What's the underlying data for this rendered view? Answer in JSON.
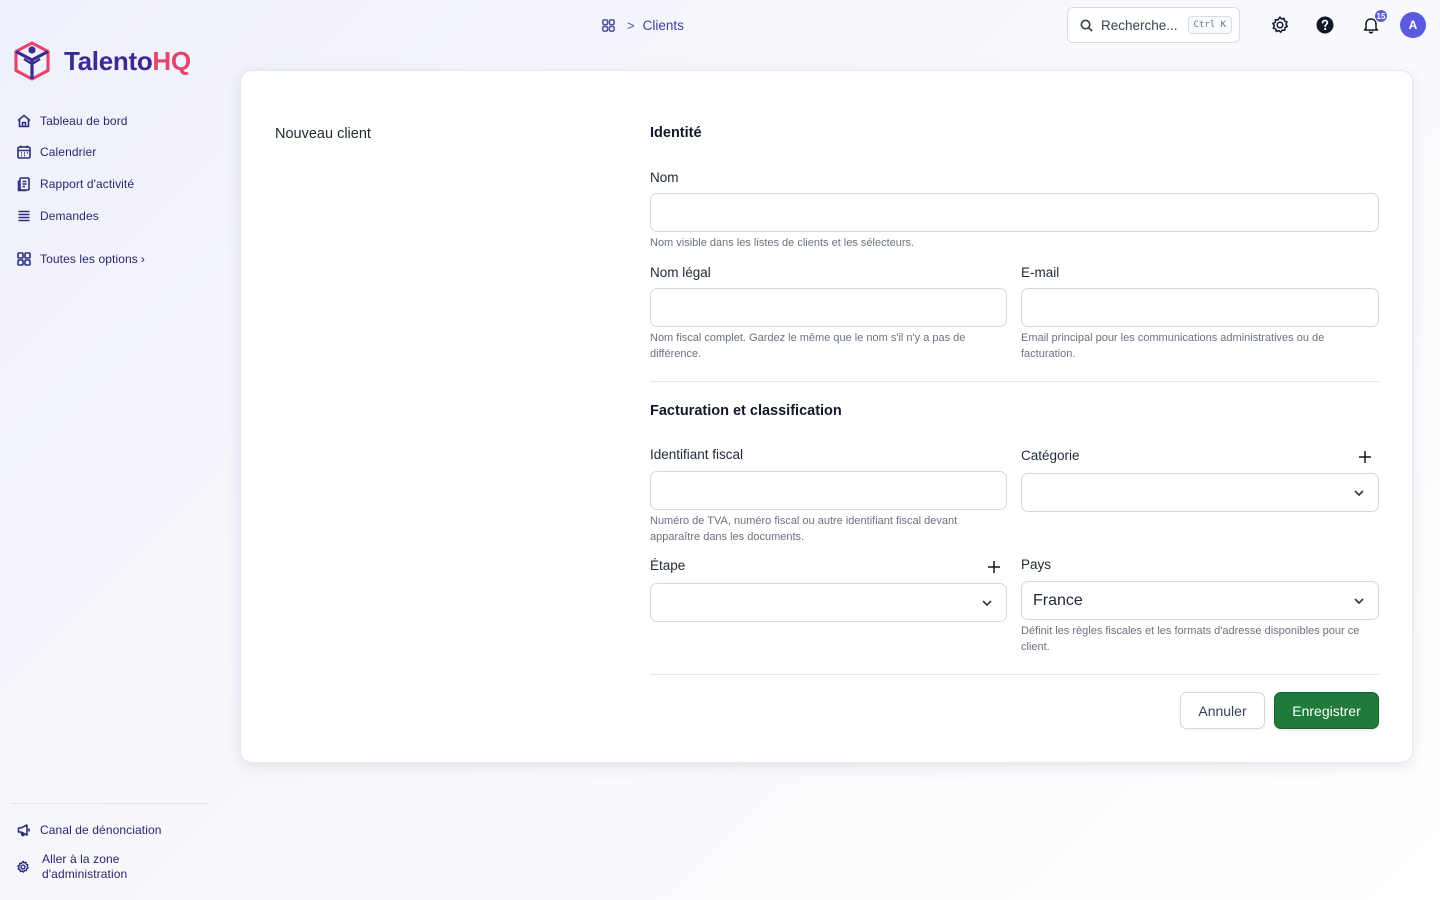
{
  "brand": {
    "name_part1": "Talento",
    "name_part2": "HQ",
    "color_primary": "#3b2a8f",
    "color_accent": "#e3456c"
  },
  "sidebar": {
    "items": [
      {
        "label": "Tableau de bord",
        "icon": "home-icon"
      },
      {
        "label": "Calendrier",
        "icon": "calendar-icon"
      },
      {
        "label": "Rapport d'activité",
        "icon": "report-icon"
      },
      {
        "label": "Demandes",
        "icon": "list-icon"
      },
      {
        "label": "Toutes les options",
        "icon": "grid-icon",
        "chevron": "›"
      }
    ],
    "footer": [
      {
        "label": "Canal de dénonciation",
        "icon": "megaphone-icon"
      },
      {
        "label_line1": "Aller à la zone",
        "label_line2": "d'administration",
        "icon": "gear-icon"
      }
    ]
  },
  "topbar": {
    "breadcrumb": {
      "current": "Clients",
      "separator": ">"
    },
    "search": {
      "placeholder": "Recherche...",
      "shortcut": "Ctrl K"
    },
    "notifications_count": "15",
    "avatar_initial": "A"
  },
  "form": {
    "title": "Nouveau client",
    "identity": {
      "section_title": "Identité",
      "nom": {
        "label": "Nom",
        "value": "",
        "help": "Nom visible dans les listes de clients et les sélecteurs."
      },
      "nom_legal": {
        "label": "Nom légal",
        "value": "",
        "help": "Nom fiscal complet. Gardez le même que le nom s'il n'y a pas de différence."
      },
      "email": {
        "label": "E-mail",
        "value": "",
        "help": "Email principal pour les communications administratives ou de facturation."
      }
    },
    "billing": {
      "section_title": "Facturation et classification",
      "identifiant_fiscal": {
        "label": "Identifiant fiscal",
        "value": "",
        "help": "Numéro de TVA, numéro fiscal ou autre identifiant fiscal devant apparaître dans les documents."
      },
      "categorie": {
        "label": "Catégorie",
        "value": ""
      },
      "etape": {
        "label": "Étape",
        "value": ""
      },
      "pays": {
        "label": "Pays",
        "value": "France",
        "help": "Définit les règles fiscales et les formats d'adresse disponibles pour ce client."
      }
    },
    "actions": {
      "cancel": "Annuler",
      "save": "Enregistrer",
      "save_color": "#1f7a3b"
    }
  }
}
